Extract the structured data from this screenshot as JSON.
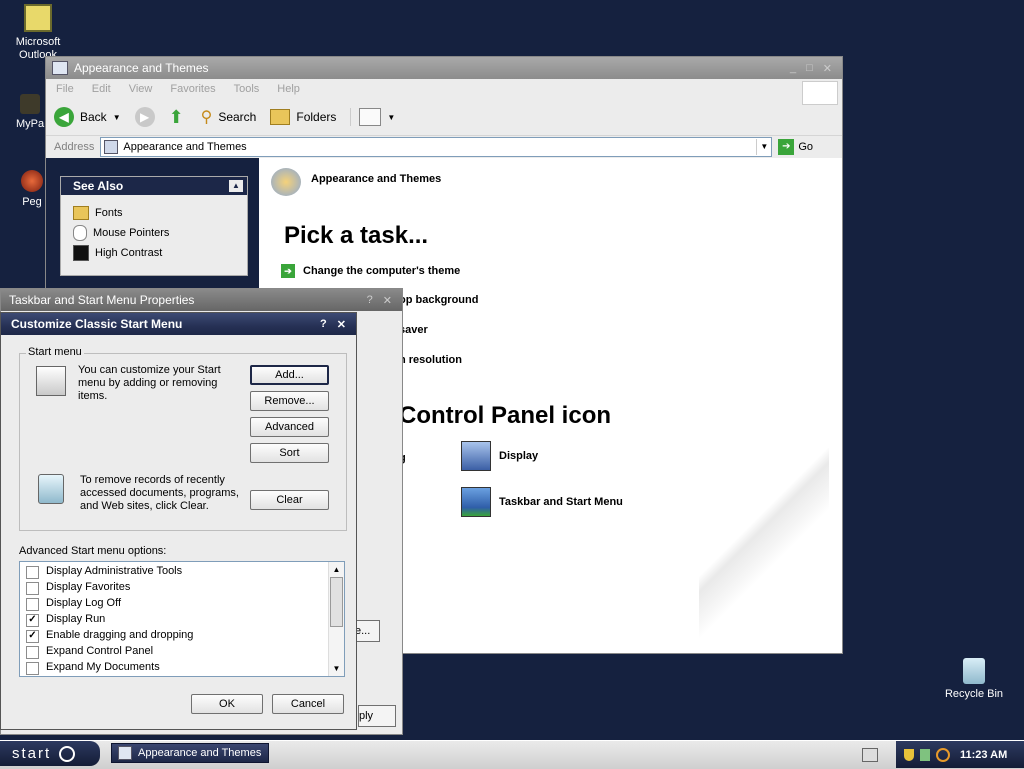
{
  "desktop": {
    "icons": [
      {
        "label": "Microsoft Outlook",
        "icon": "outlook-icon"
      },
      {
        "label": "MyPa",
        "icon": "my-pictures-icon"
      },
      {
        "label": "Peg",
        "icon": "pegasus-icon"
      },
      {
        "label": "Recycle Bin",
        "icon": "recycle-bin-icon"
      }
    ]
  },
  "explorer": {
    "title": "Appearance and Themes",
    "menu": [
      "File",
      "Edit",
      "View",
      "Favorites",
      "Tools",
      "Help"
    ],
    "toolbar": {
      "back": "Back",
      "search": "Search",
      "folders": "Folders"
    },
    "address": {
      "label": "Address",
      "value": "Appearance and Themes",
      "go": "Go"
    },
    "see_also": {
      "title": "See Also",
      "items": [
        "Fonts",
        "Mouse Pointers",
        "High Contrast"
      ]
    },
    "heading": "Appearance and Themes",
    "pick_task": "Pick a task...",
    "tasks": [
      "Change the computer's theme",
      "op background",
      "saver",
      "n resolution"
    ],
    "cp_heading": "Control Panel icon",
    "cp_icons": [
      "g",
      "Display",
      "Taskbar and Start Menu"
    ]
  },
  "taskbar_props": {
    "title": "Taskbar and Start Menu Properties",
    "apply_label": "ply",
    "btn_fragment": "e..."
  },
  "dialog": {
    "title": "Customize Classic Start Menu",
    "group_label": "Start menu",
    "customize_text": "You can customize your Start menu by adding or removing items.",
    "clear_text": "To remove records of recently accessed documents, programs, and Web sites, click Clear.",
    "buttons": {
      "add": "Add...",
      "remove": "Remove...",
      "advanced": "Advanced",
      "sort": "Sort",
      "clear": "Clear",
      "ok": "OK",
      "cancel": "Cancel"
    },
    "options_label": "Advanced Start menu options:",
    "options": [
      {
        "label": "Display Administrative Tools",
        "checked": false
      },
      {
        "label": "Display Favorites",
        "checked": false
      },
      {
        "label": "Display Log Off",
        "checked": false
      },
      {
        "label": "Display Run",
        "checked": true
      },
      {
        "label": "Enable dragging and dropping",
        "checked": true
      },
      {
        "label": "Expand Control Panel",
        "checked": false
      },
      {
        "label": "Expand My Documents",
        "checked": false
      }
    ]
  },
  "taskbar": {
    "start_label": "start",
    "task_button": "Appearance and Themes",
    "clock": "11:23 AM"
  }
}
